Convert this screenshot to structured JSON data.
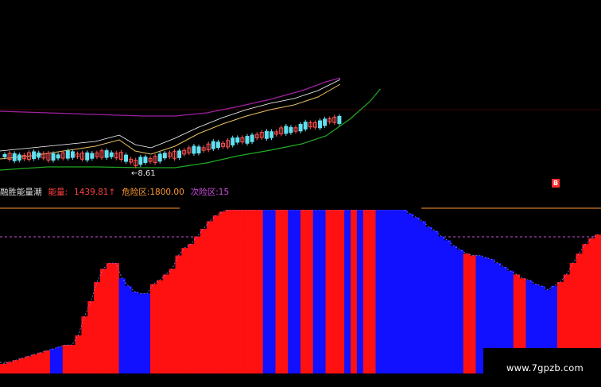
{
  "info": {
    "title": "融胜能量潮",
    "energy_label": "能量:",
    "energy_value": "1439.81",
    "energy_arrow": "↑",
    "danger_label": "危险区:",
    "danger_value": "1800.00",
    "second_label": "次险区:",
    "second_value": "15"
  },
  "price_low_label": "←8.61",
  "signal_marker": "B",
  "watermark": "www.7gpzb.com",
  "colors": {
    "bull": "#ff1111",
    "bear": "#1111ff",
    "upper_band": "#a020a0",
    "lower_band": "#22aa22",
    "ma": "#e8c060",
    "danger_line": "#ff9933",
    "second_line": "#d050e0"
  },
  "chart_data": {
    "type": "bar",
    "title": "",
    "series": [
      {
        "values": [
          5,
          6,
          7,
          8,
          9,
          10,
          11,
          12,
          13,
          14,
          15,
          15,
          20,
          30,
          38,
          48,
          55,
          58,
          58,
          50,
          46,
          43,
          42,
          42,
          47,
          49,
          52,
          55,
          62,
          66,
          68,
          72,
          76,
          80,
          83,
          85,
          86,
          86,
          86,
          86,
          86,
          86,
          86,
          86,
          86,
          86,
          86,
          86,
          86,
          86,
          86,
          86,
          86,
          86,
          86,
          86,
          86,
          86,
          86,
          86,
          86,
          86,
          86,
          86,
          86,
          84,
          82,
          80,
          77,
          75,
          72,
          70,
          67,
          65,
          63,
          62,
          62,
          61,
          60,
          58,
          56,
          54,
          52,
          50,
          49,
          47,
          46,
          44,
          46,
          48,
          52,
          58,
          63,
          68,
          71,
          73
        ],
        "colors": [
          "r",
          "r",
          "r",
          "r",
          "r",
          "r",
          "r",
          "r",
          "b",
          "b",
          "r",
          "r",
          "r",
          "r",
          "r",
          "r",
          "r",
          "r",
          "r",
          "b",
          "b",
          "b",
          "b",
          "b",
          "r",
          "r",
          "r",
          "r",
          "r",
          "r",
          "r",
          "r",
          "r",
          "r",
          "r",
          "r",
          "r",
          "r",
          "r",
          "r",
          "r",
          "r",
          "b",
          "b",
          "r",
          "r",
          "b",
          "b",
          "r",
          "r",
          "b",
          "b",
          "r",
          "r",
          "r",
          "b",
          "r",
          "b",
          "r",
          "r",
          "b",
          "b",
          "b",
          "b",
          "b",
          "b",
          "b",
          "b",
          "b",
          "b",
          "b",
          "b",
          "b",
          "b",
          "r",
          "r",
          "b",
          "b",
          "b",
          "b",
          "b",
          "b",
          "r",
          "r",
          "b",
          "b",
          "b",
          "b",
          "b",
          "r",
          "r",
          "r",
          "r",
          "r",
          "r",
          "r"
        ]
      }
    ]
  }
}
